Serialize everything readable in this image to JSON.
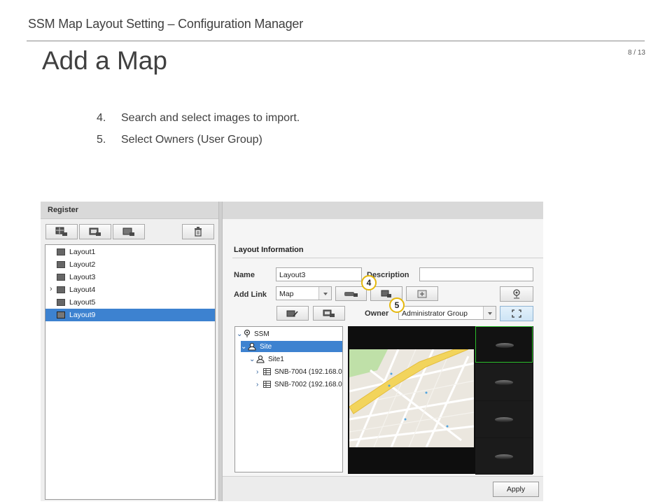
{
  "slide": {
    "doc_title": "SSM Map Layout Setting – Configuration Manager",
    "page_title": "Add a Map",
    "page_number": "8 / 13",
    "steps": [
      {
        "num": "4.",
        "text": "Search and select images to import."
      },
      {
        "num": "5.",
        "text": "Select Owners (User Group)"
      }
    ]
  },
  "app": {
    "register_label": "Register",
    "toolbar_icons": [
      "add-layout-icon",
      "add-map-icon",
      "add-image-icon",
      "trash-icon"
    ],
    "layouts": [
      {
        "label": "Layout1",
        "selected": false,
        "expandable": false
      },
      {
        "label": "Layout2",
        "selected": false,
        "expandable": false
      },
      {
        "label": "Layout3",
        "selected": false,
        "expandable": false
      },
      {
        "label": "Layout4",
        "selected": false,
        "expandable": true
      },
      {
        "label": "Layout5",
        "selected": false,
        "expandable": false
      },
      {
        "label": "Layout9",
        "selected": true,
        "expandable": false
      }
    ],
    "layout_info": {
      "section_title": "Layout Information",
      "name_label": "Name",
      "name_value": "Layout3",
      "description_label": "Description",
      "description_value": "",
      "add_link_label": "Add Link",
      "add_link_value": "Map",
      "owner_label": "Owner",
      "owner_value": "Administrator Group"
    },
    "badges": {
      "four": "4",
      "five": "5"
    },
    "tree": [
      {
        "label": "SSM",
        "icon": "map-pin-icon",
        "expanded": true,
        "selected": false,
        "level": 0
      },
      {
        "label": "Site",
        "icon": "user-group-icon",
        "expanded": true,
        "selected": true,
        "level": 1
      },
      {
        "label": "Site1",
        "icon": "user-group-icon",
        "expanded": true,
        "selected": false,
        "level": 2
      },
      {
        "label": "SNB-7004 (192.168.0",
        "icon": "device-grid-icon",
        "expanded": false,
        "selected": false,
        "level": 3
      },
      {
        "label": "SNB-7002 (192.168.0",
        "icon": "device-grid-icon",
        "expanded": false,
        "selected": false,
        "level": 3
      }
    ],
    "apply_label": "Apply",
    "colors": {
      "selection": "#3d82d0",
      "badge_ring": "#e5b80b",
      "thumb_active": "#2bbd2b"
    }
  }
}
